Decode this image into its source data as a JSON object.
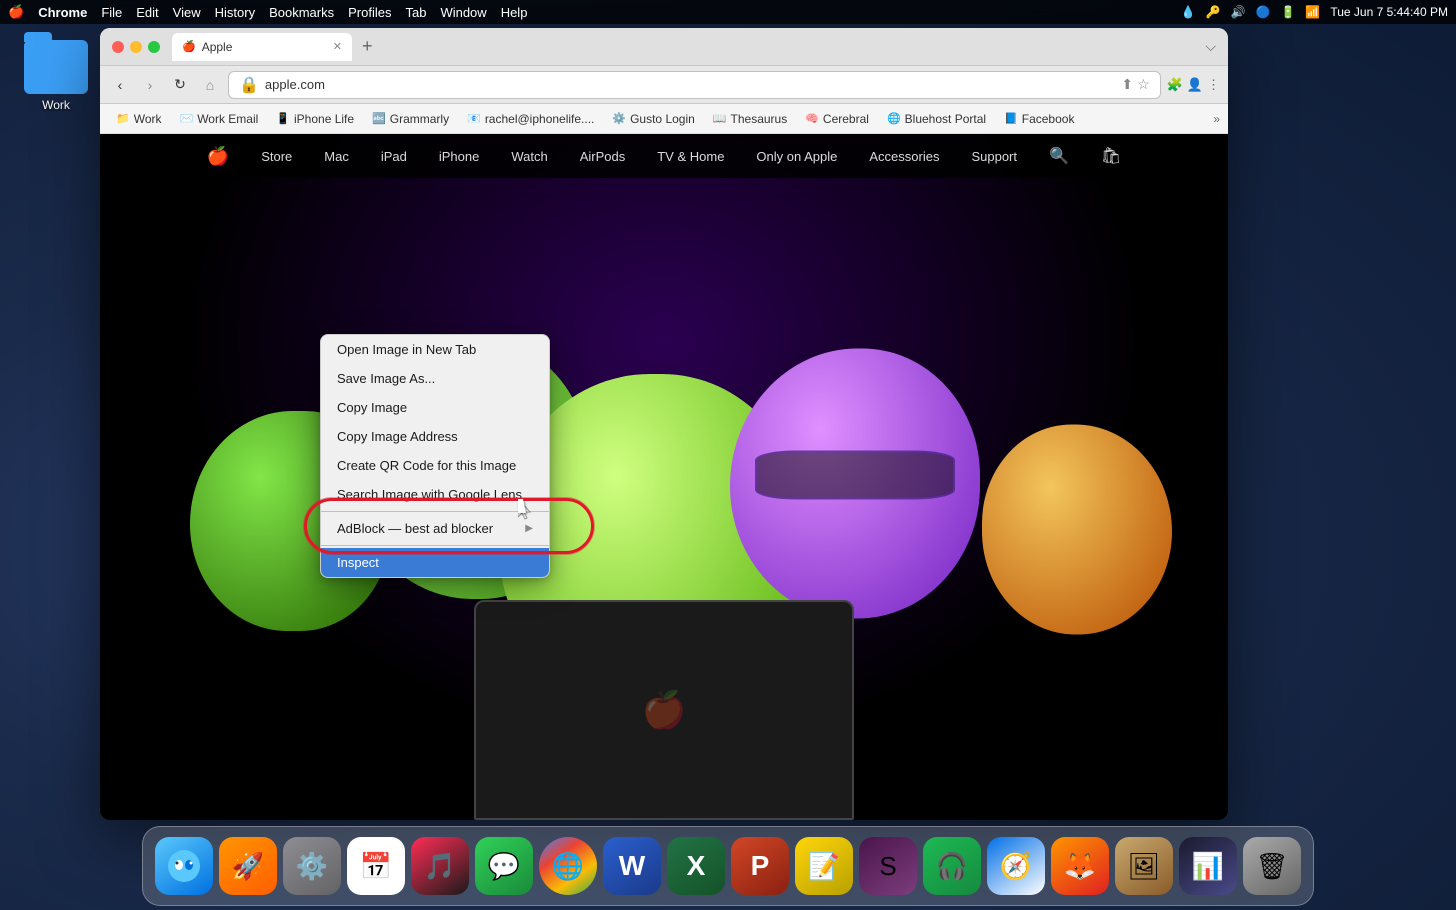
{
  "desktop": {
    "background": "macOS desktop"
  },
  "menubar": {
    "apple_logo": "🍎",
    "chrome_label": "Chrome",
    "file_label": "File",
    "edit_label": "Edit",
    "view_label": "View",
    "history_label": "History",
    "bookmarks_label": "Bookmarks",
    "profiles_label": "Profiles",
    "tab_label": "Tab",
    "window_label": "Window",
    "help_label": "Help",
    "datetime": "Tue Jun 7  5:44:40 PM"
  },
  "browser": {
    "tab_title": "Apple",
    "tab_favicon": "🍎",
    "url": "apple.com",
    "new_tab_label": "+",
    "options_label": "⌵"
  },
  "bookmarks": [
    {
      "label": "Work",
      "favicon": "📁"
    },
    {
      "label": "Work Email",
      "favicon": "✉️"
    },
    {
      "label": "iPhone Life",
      "favicon": "📱"
    },
    {
      "label": "Grammarly",
      "favicon": "🔤"
    },
    {
      "label": "rachel@iphonelife....",
      "favicon": "📧"
    },
    {
      "label": "Gusto Login",
      "favicon": "⚙️"
    },
    {
      "label": "Thesaurus",
      "favicon": "📖"
    },
    {
      "label": "Cerebral",
      "favicon": "🧠"
    },
    {
      "label": "Bluehost Portal",
      "favicon": "🌐"
    },
    {
      "label": "Facebook",
      "favicon": "📘"
    }
  ],
  "apple_nav": {
    "logo": "",
    "items": [
      "Store",
      "Mac",
      "iPad",
      "iPhone",
      "Watch",
      "AirPods",
      "TV & Home",
      "Only on Apple",
      "Accessories",
      "Support"
    ]
  },
  "context_menu": {
    "items": [
      {
        "label": "Open Image in New Tab",
        "has_arrow": false
      },
      {
        "label": "Save Image As...",
        "has_arrow": false
      },
      {
        "label": "Copy Image",
        "has_arrow": false
      },
      {
        "label": "Copy Image Address",
        "has_arrow": false
      },
      {
        "label": "Create QR Code for this Image",
        "has_arrow": false
      },
      {
        "label": "Search Image with Google Lens",
        "has_arrow": false
      },
      {
        "label": "AdBlock — best ad blocker",
        "has_arrow": true
      },
      {
        "label": "Inspect",
        "highlighted": true,
        "has_arrow": false
      }
    ]
  },
  "dock": {
    "icons": [
      {
        "name": "finder",
        "emoji": "😊",
        "label": "Finder"
      },
      {
        "name": "launchpad",
        "emoji": "🚀",
        "label": "Launchpad"
      },
      {
        "name": "system-preferences",
        "emoji": "⚙️",
        "label": "System Preferences"
      },
      {
        "name": "calendar",
        "emoji": "📅",
        "label": "Calendar"
      },
      {
        "name": "music",
        "emoji": "🎵",
        "label": "Music"
      },
      {
        "name": "messages",
        "emoji": "💬",
        "label": "Messages"
      },
      {
        "name": "chrome",
        "emoji": "🌐",
        "label": "Chrome"
      },
      {
        "name": "word",
        "emoji": "W",
        "label": "Word"
      },
      {
        "name": "excel",
        "emoji": "X",
        "label": "Excel"
      },
      {
        "name": "powerpoint",
        "emoji": "P",
        "label": "PowerPoint"
      },
      {
        "name": "notes",
        "emoji": "📝",
        "label": "Notes"
      },
      {
        "name": "slack",
        "emoji": "S",
        "label": "Slack"
      },
      {
        "name": "spotify",
        "emoji": "♪",
        "label": "Spotify"
      },
      {
        "name": "safari",
        "emoji": "🧭",
        "label": "Safari"
      },
      {
        "name": "firefox",
        "emoji": "🦊",
        "label": "Firefox"
      },
      {
        "name": "preview",
        "emoji": "🖼",
        "label": "Preview"
      },
      {
        "name": "istat",
        "emoji": "📊",
        "label": "iStat Menus"
      },
      {
        "name": "trash",
        "emoji": "🗑",
        "label": "Trash"
      }
    ]
  }
}
